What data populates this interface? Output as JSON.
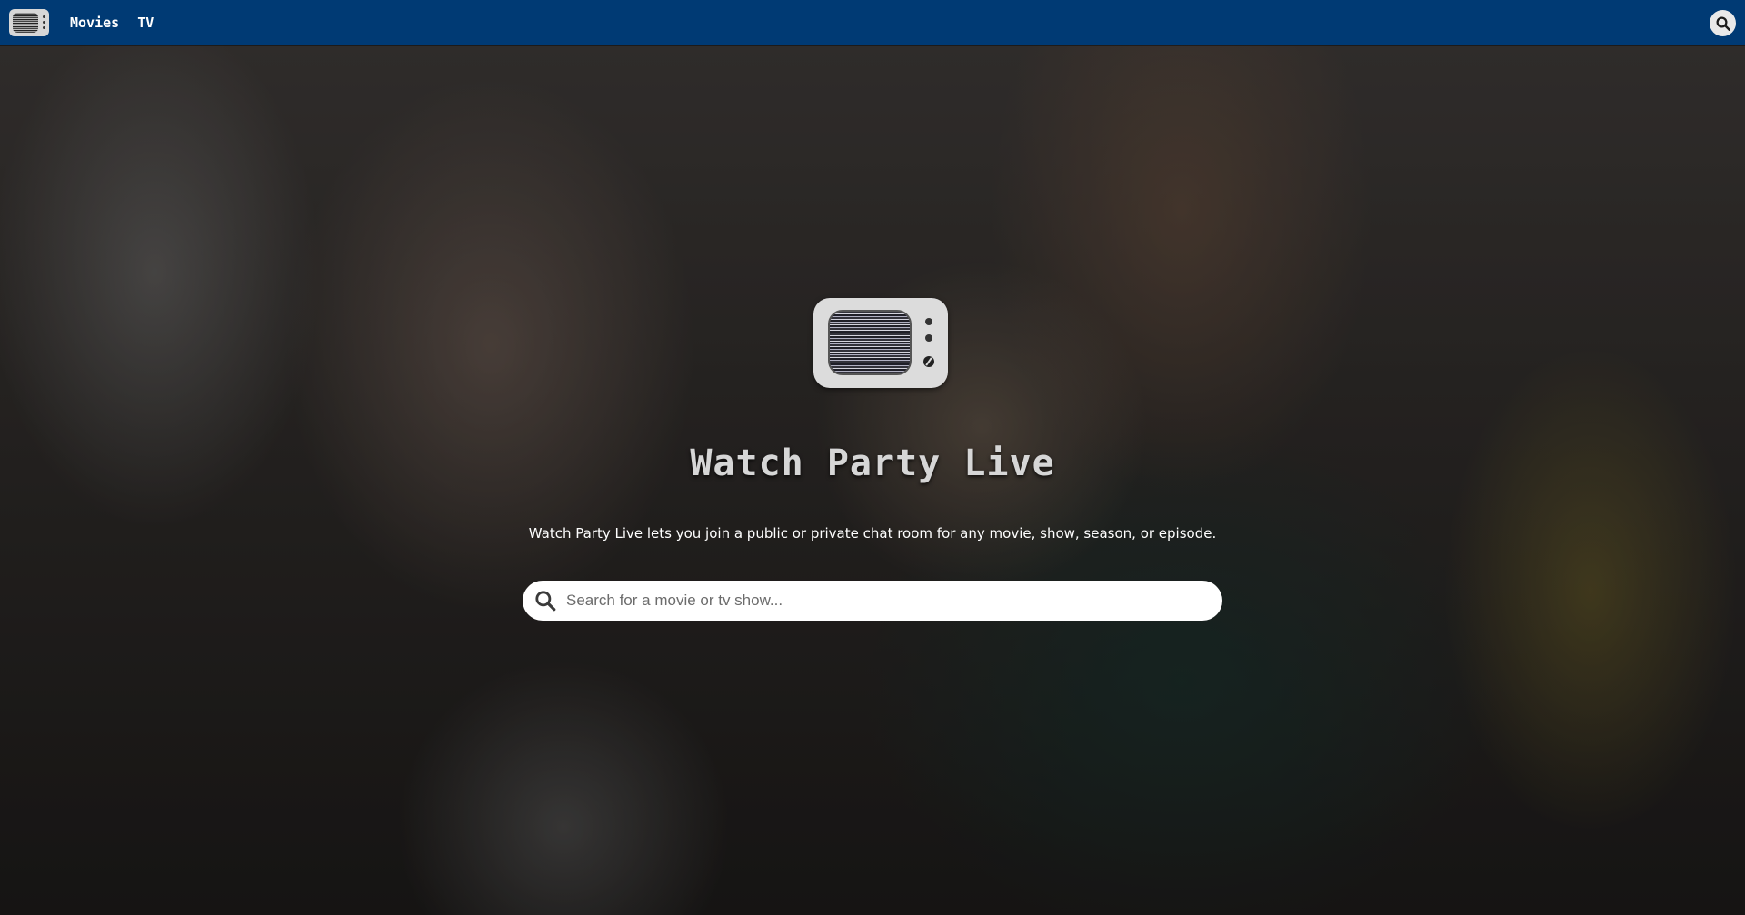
{
  "navbar": {
    "logo_icon": "tv-icon",
    "links": [
      {
        "label": "Movies"
      },
      {
        "label": "TV"
      }
    ],
    "search_icon": "search-icon",
    "background_color": "#003a74"
  },
  "hero": {
    "logo_icon": "tv-icon",
    "title": "Watch Party Live",
    "description": "Watch Party Live lets you join a public or private chat room for any movie, show, season, or episode.",
    "search": {
      "placeholder": "Search for a movie or tv show...",
      "value": "",
      "icon": "search-icon"
    }
  }
}
